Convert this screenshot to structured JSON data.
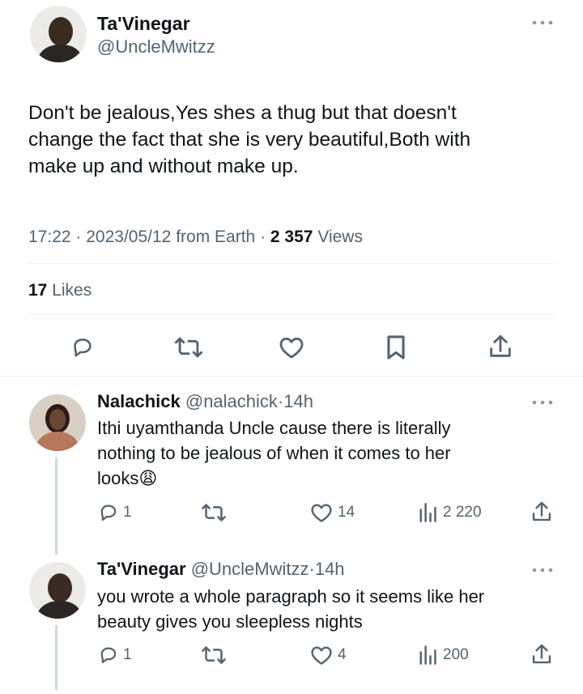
{
  "main_tweet": {
    "author_name": "Ta'Vinegar",
    "author_handle": "@UncleMwitzz",
    "text_lines": [
      "Don't be jealous,Yes shes a thug but that doesn't",
      "change the fact that she is very beautiful,Both with",
      "make up and without make up."
    ],
    "time": "17:22",
    "date": "2023/05/12",
    "source": "from Earth",
    "views_count": "2 357",
    "views_label": "Views",
    "likes_count": "17",
    "likes_label": "Likes"
  },
  "replies": [
    {
      "author_name": "Nalachick",
      "author_handle": "@nalachick",
      "age": "14h",
      "text_lines": [
        "Ithi uyamthanda Uncle cause there is literally",
        "nothing to be jealous of when it comes to her",
        "looks"
      ],
      "emoji": "😩",
      "reply_count": "1",
      "retweet_count": "",
      "like_count": "14",
      "view_count": "2 220"
    },
    {
      "author_name": "Ta'Vinegar",
      "author_handle": "@UncleMwitzz",
      "age": "14h",
      "text_lines": [
        "you wrote a whole paragraph so it seems like her",
        "beauty gives you sleepless nights"
      ],
      "reply_count": "1",
      "retweet_count": "",
      "like_count": "4",
      "view_count": "200"
    }
  ],
  "separator": "·",
  "more_glyph": "•••",
  "colors": {
    "text": "#0f1419",
    "muted": "#536471",
    "divider": "#eff3f4",
    "thread_line": "#cfd9de"
  },
  "icons": [
    "reply-icon",
    "retweet-icon",
    "like-icon",
    "bookmark-icon",
    "share-icon",
    "views-icon",
    "more-icon"
  ]
}
